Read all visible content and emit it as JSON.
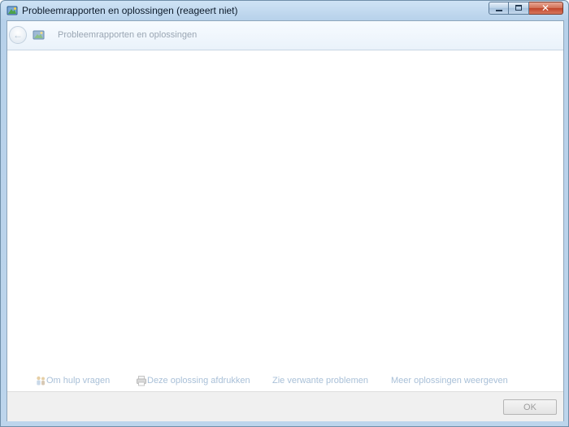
{
  "window": {
    "title": "Probleemrapporten en oplossingen (reageert niet)",
    "close_glyph": "✕"
  },
  "nav": {
    "back_glyph": "←",
    "title": "Probleemrapporten en oplossingen"
  },
  "actions": {
    "ask_help": "Om hulp vragen",
    "print_solution": "Deze oplossing afdrukken",
    "related_problems": "Zie verwante problemen",
    "more_solutions": "Meer oplossingen weergeven"
  },
  "buttons": {
    "ok": "OK"
  },
  "icons": {
    "title": "problem-reports-icon",
    "nav": "problem-reports-icon",
    "ask_help": "people-help-icon",
    "print": "printer-icon"
  },
  "colors": {
    "link_disabled": "#a9c0d8",
    "nav_title": "#9aa6b3",
    "close_button": "#c0452a"
  }
}
